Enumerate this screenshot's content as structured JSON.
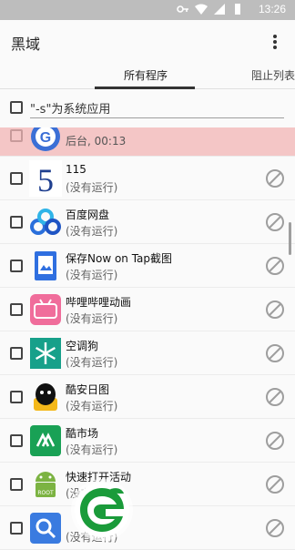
{
  "statusbar": {
    "time": "13:26"
  },
  "appbar": {
    "title": "黑域"
  },
  "tabs": [
    {
      "label": "所有程序",
      "active": true
    },
    {
      "label": "阻止列表",
      "active": false
    }
  ],
  "filter": {
    "label": "\"-s\"为系统应用"
  },
  "apps": [
    {
      "name": "",
      "status": "后台, 00:13",
      "highlight": true,
      "icon": "gear-g-icon",
      "blockable": false
    },
    {
      "name": "115",
      "status": "(没有运行)",
      "highlight": false,
      "icon": "app-115-icon",
      "blockable": true
    },
    {
      "name": "百度网盘",
      "status": "(没有运行)",
      "highlight": false,
      "icon": "baidu-netdisk-icon",
      "blockable": true
    },
    {
      "name": "保存Now on Tap截图",
      "status": "(没有运行)",
      "highlight": false,
      "icon": "save-screenshot-icon",
      "blockable": true
    },
    {
      "name": "哔哩哔哩动画",
      "status": "(没有运行)",
      "highlight": false,
      "icon": "bilibili-icon",
      "blockable": true
    },
    {
      "name": "空调狗",
      "status": "(没有运行)",
      "highlight": false,
      "icon": "snowflake-icon",
      "blockable": true
    },
    {
      "name": "酷安日图",
      "status": "(没有运行)",
      "highlight": false,
      "icon": "coolapk-daily-icon",
      "blockable": true
    },
    {
      "name": "酷市场",
      "status": "(没有运行)",
      "highlight": false,
      "icon": "coolmarket-icon",
      "blockable": true
    },
    {
      "name": "快速打开活动",
      "status": "(没有运行)",
      "highlight": false,
      "icon": "android-root-icon",
      "blockable": true
    },
    {
      "name": "",
      "status": "(没有运行)",
      "highlight": false,
      "icon": "search-app-icon",
      "blockable": true
    }
  ],
  "colors": {
    "highlight": "#f4c6c6",
    "accent": "#333333",
    "watermark": "#1a9b3a"
  }
}
